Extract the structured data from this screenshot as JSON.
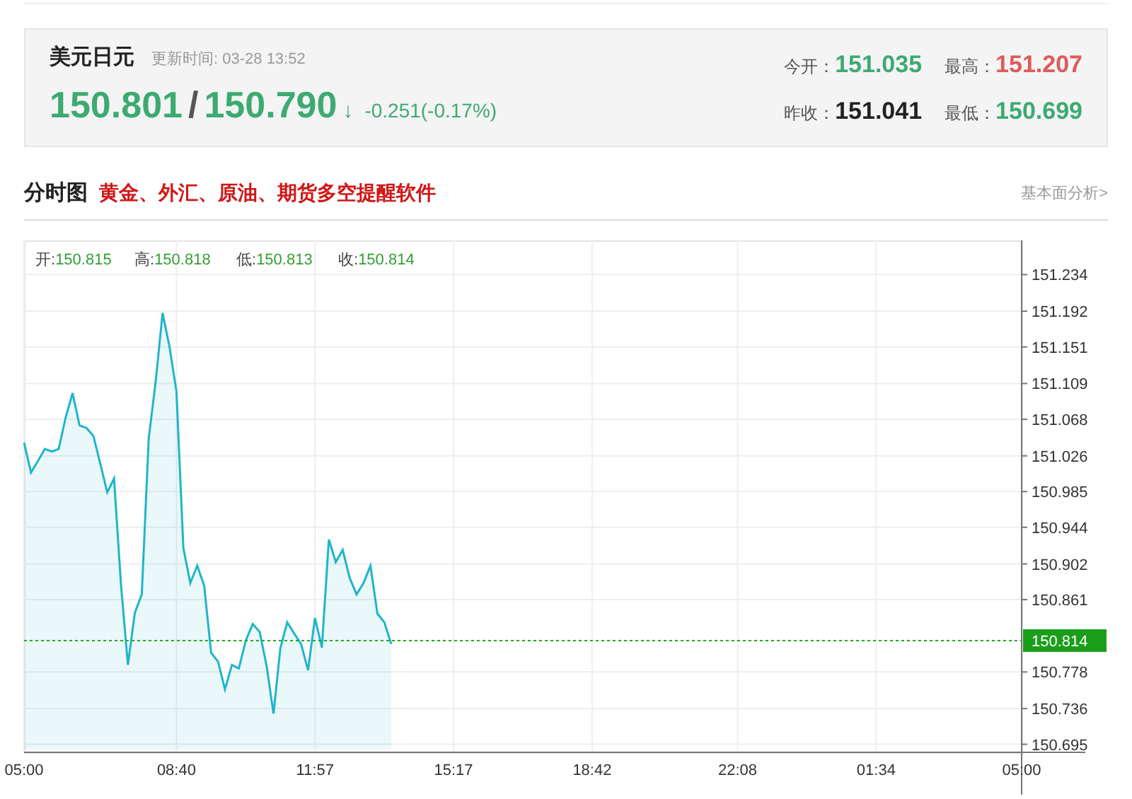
{
  "quote": {
    "symbol": "美元日元",
    "update_label": "更新时间:",
    "update_time": "03-28 13:52",
    "bid": "150.801",
    "separator": "/",
    "ask": "150.790",
    "direction": "↓",
    "change": "-0.251(-0.17%)",
    "stats": [
      {
        "label": "今开：",
        "value": "151.035",
        "color": "#3daa72"
      },
      {
        "label": "最高：",
        "value": "151.207",
        "color": "#e05a5a"
      },
      {
        "label": "昨收：",
        "value": "151.041",
        "color": "#222222"
      },
      {
        "label": "最低：",
        "value": "150.699",
        "color": "#3daa72"
      }
    ]
  },
  "section": {
    "title": "分时图",
    "promo": "黄金、外汇、原油、期货多空提醒软件",
    "link": "基本面分析>"
  },
  "chart": {
    "legend": [
      {
        "label": "开:",
        "value": "150.815"
      },
      {
        "label": "高:",
        "value": "150.818"
      },
      {
        "label": "低:",
        "value": "150.813"
      },
      {
        "label": "收:",
        "value": "150.814"
      }
    ],
    "last_price": "150.814",
    "chart_data": {
      "type": "area",
      "grid": true,
      "ylim": [
        150.689,
        151.27
      ],
      "ref_lines": [
        {
          "axis": "y",
          "value": 150.814,
          "color": "#22aa22"
        }
      ],
      "categories": [
        "05:00",
        null,
        null,
        null,
        null,
        null,
        null,
        null,
        null,
        null,
        null,
        null,
        null,
        null,
        null,
        null,
        null,
        null,
        null,
        null,
        null,
        null,
        "08:40",
        null,
        null,
        null,
        null,
        null,
        null,
        null,
        null,
        null,
        null,
        null,
        null,
        null,
        null,
        null,
        null,
        null,
        null,
        null,
        "11:57",
        null,
        null,
        null,
        null,
        null,
        null,
        null,
        null,
        null,
        null,
        null,
        null,
        null,
        null,
        null,
        null,
        null,
        null,
        null,
        "15:17",
        null,
        null,
        null,
        null,
        null,
        null,
        null,
        null,
        null,
        null,
        null,
        null,
        null,
        null,
        null,
        null,
        null,
        null,
        null,
        "18:42",
        null,
        null,
        null,
        null,
        null,
        null,
        null,
        null,
        null,
        null,
        null,
        null,
        null,
        null,
        null,
        null,
        null,
        null,
        null,
        null,
        "22:08",
        null,
        null,
        null,
        null,
        null,
        null,
        null,
        null,
        null,
        null,
        null,
        null,
        null,
        null,
        null,
        null,
        null,
        null,
        null,
        "01:34",
        null,
        null,
        null,
        null,
        null,
        null,
        null,
        null,
        null,
        null,
        null,
        null,
        null,
        null,
        null,
        null,
        null,
        null,
        null,
        null,
        "05:00"
      ],
      "series": [
        {
          "color": "#1fb5cc",
          "values": [
            151.041,
            151.007,
            151.02,
            151.034,
            151.031,
            151.034,
            151.07,
            151.098,
            151.061,
            151.058,
            151.049,
            151.017,
            150.984,
            151.0,
            150.878,
            150.786,
            150.846,
            150.867,
            151.046,
            151.111,
            151.19,
            151.151,
            151.1,
            150.92,
            150.88,
            150.9,
            150.877,
            150.8,
            150.79,
            150.758,
            150.786,
            150.782,
            150.814,
            150.833,
            150.824,
            150.785,
            150.73,
            150.805,
            150.835,
            150.822,
            150.81,
            150.78,
            150.84,
            150.806,
            150.93,
            150.904,
            150.918,
            150.886,
            150.867,
            150.88,
            150.9,
            150.845,
            150.835,
            150.81,
            null,
            null,
            null,
            null,
            null,
            null,
            null,
            null,
            null,
            null,
            null,
            null,
            null,
            null,
            null,
            null,
            null,
            null,
            null,
            null,
            null,
            null,
            null,
            null,
            null,
            null,
            null,
            null,
            null,
            null,
            null,
            null,
            null,
            null,
            null,
            null,
            null,
            null,
            null,
            null,
            null,
            null,
            null,
            null,
            null,
            null,
            null,
            null,
            null,
            null,
            null,
            null,
            null,
            null,
            null,
            null,
            null,
            null,
            null,
            null,
            null,
            null,
            null,
            null,
            null,
            null,
            null,
            null,
            null,
            null,
            null,
            null,
            null,
            null,
            null,
            null,
            null,
            null,
            null,
            null,
            null,
            null,
            null,
            null,
            null,
            null,
            null,
            null,
            null,
            null,
            null
          ]
        }
      ],
      "yticks": [
        151.234,
        151.192,
        151.151,
        151.109,
        151.068,
        151.026,
        150.985,
        150.944,
        150.902,
        150.861,
        150.778,
        150.736,
        150.695
      ]
    }
  }
}
